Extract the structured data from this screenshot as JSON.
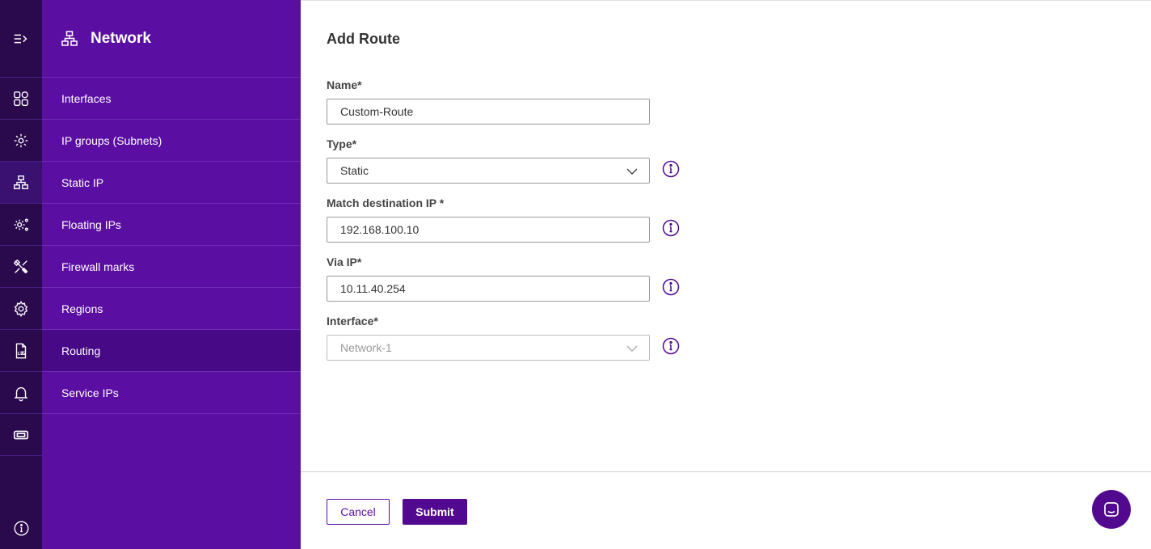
{
  "sidebar": {
    "title": "Network",
    "items": [
      {
        "label": "Interfaces",
        "active": false
      },
      {
        "label": "IP groups (Subnets)",
        "active": false
      },
      {
        "label": "Static IP",
        "active": false
      },
      {
        "label": "Floating IPs",
        "active": false
      },
      {
        "label": "Firewall marks",
        "active": false
      },
      {
        "label": "Regions",
        "active": false
      },
      {
        "label": "Routing",
        "active": true
      },
      {
        "label": "Service IPs",
        "active": false
      }
    ]
  },
  "rail": {
    "icons": [
      "expand-menu-icon",
      "dashboard-icon",
      "settings-network-icon",
      "network-icon",
      "settings-advanced-icon",
      "tools-icon",
      "settings-icon",
      "log-file-icon",
      "bell-icon",
      "ticket-icon",
      "info-icon"
    ],
    "active": "network-icon"
  },
  "form": {
    "title": "Add Route",
    "name_label": "Name*",
    "name_value": "Custom-Route",
    "type_label": "Type*",
    "type_value": "Static",
    "dest_label": "Match destination IP *",
    "dest_value": "192.168.100.10",
    "via_label": "Via IP*",
    "via_value": "10.11.40.254",
    "interface_label": "Interface*",
    "interface_value": "Network-1"
  },
  "actions": {
    "cancel_label": "Cancel",
    "submit_label": "Submit"
  },
  "colors": {
    "rail_bg": "#2a0a4d",
    "sidebar_bg": "#5a0fa2",
    "sidebar_active": "#470986",
    "primary": "#52098f"
  }
}
